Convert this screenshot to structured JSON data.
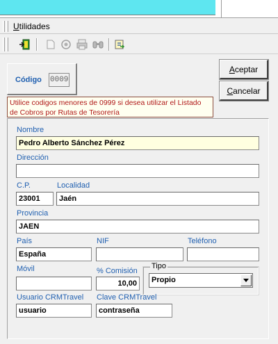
{
  "menu": {
    "utilidades_prefix": "U",
    "utilidades_rest": "tilidades"
  },
  "toolbar": {
    "icons": [
      "exit-door-icon",
      "new-document-icon",
      "preview-icon",
      "print-icon",
      "search-binoculars-icon",
      "export-icon"
    ]
  },
  "codigo": {
    "label": "Código",
    "value": "0009"
  },
  "buttons": {
    "aceptar_prefix": "A",
    "aceptar_rest": "ceptar",
    "cancelar_prefix": "C",
    "cancelar_rest": "ancelar"
  },
  "warning": "Utilice codigos menores de 0999 si desea utilizar el Listado de Cobros por Rutas de Tesorería",
  "form": {
    "nombre": {
      "label": "Nombre",
      "value": "Pedro Alberto Sánchez Pérez"
    },
    "direccion": {
      "label": "Dirección",
      "value": ""
    },
    "cp": {
      "label": "C.P.",
      "value": "23001"
    },
    "localidad": {
      "label": "Localidad",
      "value": "Jaén"
    },
    "provincia": {
      "label": "Provincia",
      "value": "JAEN"
    },
    "pais": {
      "label": "País",
      "value": "España"
    },
    "nif": {
      "label": "NIF",
      "value": ""
    },
    "telefono": {
      "label": "Teléfono",
      "value": ""
    },
    "movil": {
      "label": "Móvil",
      "value": ""
    },
    "comision": {
      "label": "% Comisión",
      "value": "10,00"
    },
    "tipo": {
      "label": "Tipo",
      "value": "Propio"
    },
    "usuario": {
      "label": "Usuario CRMTravel",
      "value": "usuario"
    },
    "clave": {
      "label": "Clave CRMTravel",
      "value": "contraseña"
    }
  },
  "colors": {
    "label_blue": "#1f5fb0",
    "warning_red": "#b01818",
    "focus_yellow": "#ffffe0",
    "top_cyan": "#5ee6f0"
  }
}
